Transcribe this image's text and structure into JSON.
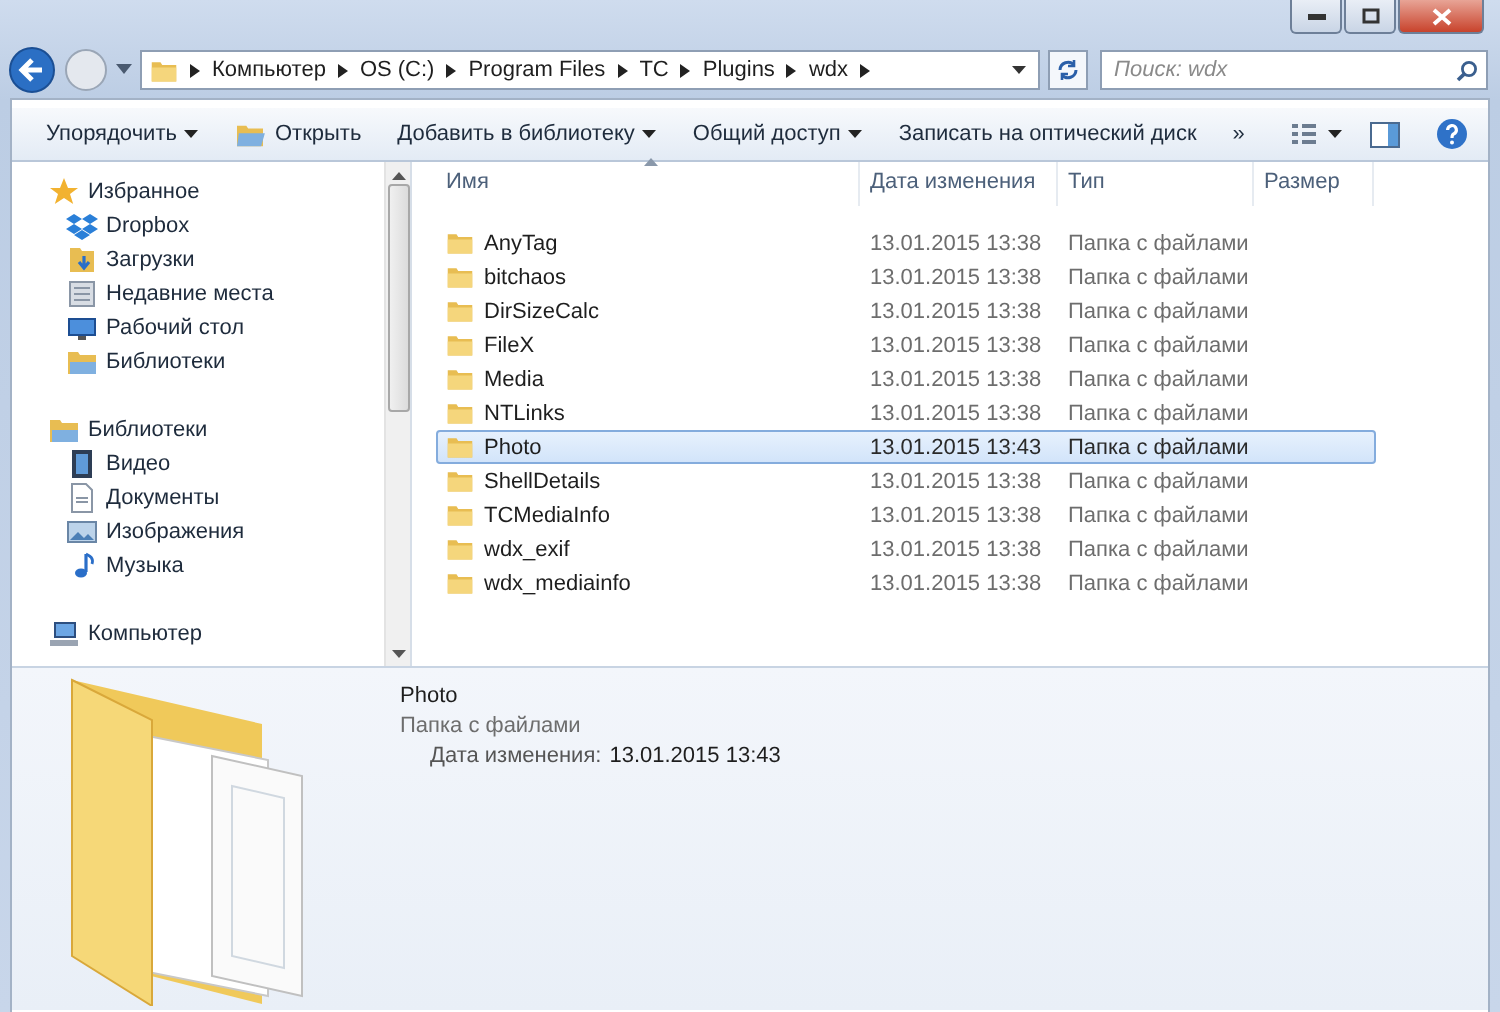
{
  "address": {
    "segments": [
      "Компьютер",
      "OS (C:)",
      "Program Files",
      "TC",
      "Plugins",
      "wdx"
    ]
  },
  "search": {
    "placeholder": "Поиск: wdx"
  },
  "toolbar": {
    "items": [
      {
        "label": "Упорядочить",
        "kind": "menu"
      },
      {
        "label": "Открыть",
        "kind": "open"
      },
      {
        "label": "Добавить в библиотеку",
        "kind": "menu"
      },
      {
        "label": "Общий доступ",
        "kind": "menu"
      },
      {
        "label": "Записать на оптический диск",
        "kind": "plain"
      },
      {
        "label": "»",
        "kind": "plain"
      }
    ]
  },
  "sidebar": {
    "groups": [
      {
        "label": "Избранное",
        "children": [
          "Dropbox",
          "Загрузки",
          "Недавние места",
          "Рабочий стол",
          "Библиотеки"
        ]
      },
      {
        "label": "Библиотеки",
        "children": [
          "Видео",
          "Документы",
          "Изображения",
          "Музыка"
        ]
      },
      {
        "label": "Компьютер"
      }
    ]
  },
  "table": {
    "columns": [
      "Имя",
      "Дата изменения",
      "Тип",
      "Размер"
    ],
    "rows": [
      {
        "name": "AnyTag",
        "date": "13.01.2015 13:38",
        "type": "Папка с файлами",
        "selected": false
      },
      {
        "name": "bitchaos",
        "date": "13.01.2015 13:38",
        "type": "Папка с файлами",
        "selected": false
      },
      {
        "name": "DirSizeCalc",
        "date": "13.01.2015 13:38",
        "type": "Папка с файлами",
        "selected": false
      },
      {
        "name": "FileX",
        "date": "13.01.2015 13:38",
        "type": "Папка с файлами",
        "selected": false
      },
      {
        "name": "Media",
        "date": "13.01.2015 13:38",
        "type": "Папка с файлами",
        "selected": false
      },
      {
        "name": "NTLinks",
        "date": "13.01.2015 13:38",
        "type": "Папка с файлами",
        "selected": false
      },
      {
        "name": "Photo",
        "date": "13.01.2015 13:43",
        "type": "Папка с файлами",
        "selected": true
      },
      {
        "name": "ShellDetails",
        "date": "13.01.2015 13:38",
        "type": "Папка с файлами",
        "selected": false
      },
      {
        "name": "TCMediaInfo",
        "date": "13.01.2015 13:38",
        "type": "Папка с файлами",
        "selected": false
      },
      {
        "name": "wdx_exif",
        "date": "13.01.2015 13:38",
        "type": "Папка с файлами",
        "selected": false
      },
      {
        "name": "wdx_mediainfo",
        "date": "13.01.2015 13:38",
        "type": "Папка с файлами",
        "selected": false
      }
    ]
  },
  "details": {
    "name": "Photo",
    "type": "Папка с файлами",
    "date_label": "Дата изменения:",
    "date_value": "13.01.2015 13:43"
  }
}
